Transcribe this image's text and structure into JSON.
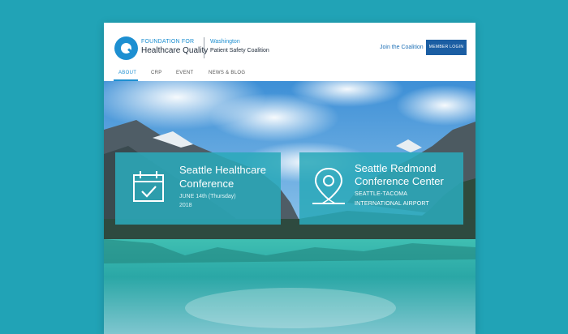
{
  "header": {
    "org_top": "FOUNDATION FOR",
    "org_main": "Healthcare Quality",
    "coalition_top": "Washington",
    "coalition_main": "Patient Safety Coalition",
    "join_link": "Join the Coalition",
    "member_button": "MEMBER LOGIN"
  },
  "nav": {
    "items": [
      {
        "label": "ABOUT",
        "active": true
      },
      {
        "label": "CRP"
      },
      {
        "label": "EVENT"
      },
      {
        "label": "NEWS & BLOG"
      }
    ]
  },
  "cards": [
    {
      "title_line1": "Seattle Healthcare",
      "title_line2": "Conference",
      "sub_line1": "JUNE 14th (Thursday)",
      "sub_line2": "2018",
      "icon": "calendar-check-icon"
    },
    {
      "title_line1": "Seattle Redmond",
      "title_line2": "Conference Center",
      "sub_line1": "SEATTLE-TACOMA",
      "sub_line2": "INTERNATIONAL AIRPORT",
      "icon": "map-pin-icon"
    }
  ],
  "colors": {
    "background": "#21a3b6",
    "accent": "#1d8fd1",
    "button": "#1b5ea3",
    "card": "#2ba9b9"
  }
}
